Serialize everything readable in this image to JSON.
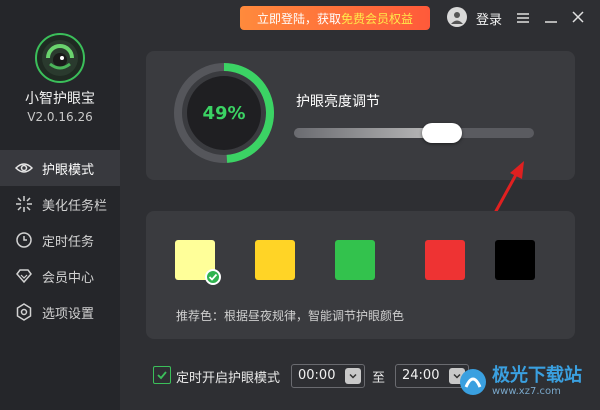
{
  "app": {
    "name": "小智护眼宝",
    "version": "V2.0.16.26"
  },
  "topbar": {
    "promo_prefix": "立即登陆，获取",
    "promo_highlight": "免费会员权益",
    "login_label": "登录",
    "menu_icon": "hamburger-menu-icon",
    "minimize_icon": "minimize-icon",
    "close_icon": "close-icon"
  },
  "sidebar": {
    "items": [
      {
        "label": "护眼模式",
        "icon": "eye-icon",
        "active": true
      },
      {
        "label": "美化任务栏",
        "icon": "sparkle-icon",
        "active": false
      },
      {
        "label": "定时任务",
        "icon": "clock-icon",
        "active": false
      },
      {
        "label": "会员中心",
        "icon": "diamond-icon",
        "active": false
      },
      {
        "label": "选项设置",
        "icon": "gear-icon",
        "active": false
      }
    ]
  },
  "brightness": {
    "percent_text": "49%",
    "percent": 49,
    "label": "护眼亮度调节",
    "slider_value": 0.49
  },
  "colors": {
    "swatches": [
      {
        "name": "pale-yellow",
        "color": "#ffff99",
        "selected": true
      },
      {
        "name": "yellow",
        "color": "#ffd426",
        "selected": false
      },
      {
        "name": "green",
        "color": "#33c24d",
        "selected": false
      },
      {
        "name": "red",
        "color": "#ee3333",
        "selected": false
      },
      {
        "name": "black",
        "color": "#000000",
        "selected": false
      }
    ],
    "recommend_text": "推荐色：根据昼夜规律，智能调节护眼颜色"
  },
  "timer": {
    "checked": true,
    "label": "定时开启护眼模式",
    "start": "00:00",
    "to_label": "至",
    "end": "24:00"
  },
  "watermark": {
    "text": "极光下载站",
    "url_text": "www.xz7.com"
  },
  "theme": {
    "accent": "#3bd364",
    "bg": "#2e2f33",
    "sidebar_bg": "#25262a",
    "card_bg": "#3a3b3f"
  }
}
